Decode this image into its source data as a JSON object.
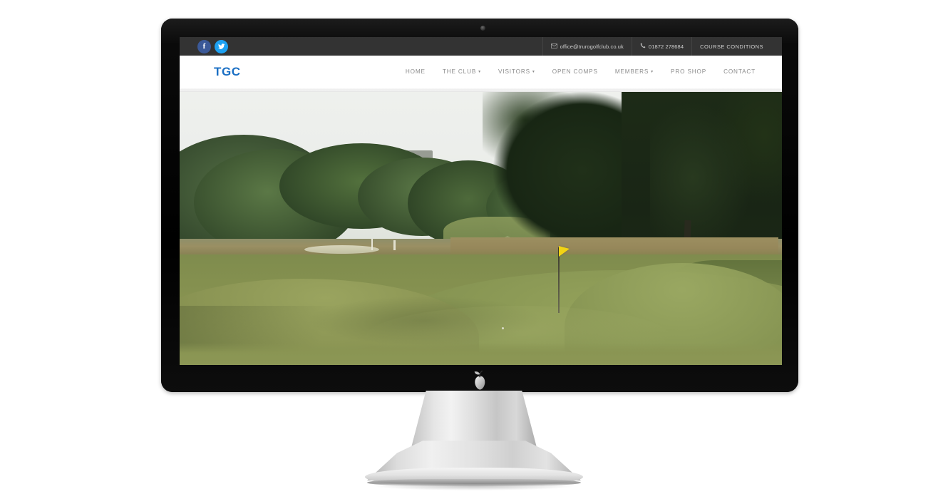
{
  "device": {
    "type": "desktop-monitor-mockup",
    "brand_logo": "pear-logo",
    "bezel_color": "#0b0b0b",
    "stand_color": "#d8d8d8"
  },
  "site": {
    "topbar": {
      "social": [
        {
          "name": "facebook",
          "glyph": "f",
          "color": "#3b5998"
        },
        {
          "name": "twitter",
          "glyph": "t",
          "color": "#1da1f2"
        }
      ],
      "contacts": [
        {
          "icon": "envelope-icon",
          "label": "office@trurogolfclub.co.uk"
        },
        {
          "icon": "phone-icon",
          "label": "01872 278684"
        }
      ],
      "link": "COURSE CONDITIONS",
      "background": "#333333",
      "text_color": "#cfcfcf"
    },
    "header": {
      "logo": "TGC",
      "logo_color": "#1a6fc4",
      "nav": [
        {
          "label": "HOME",
          "has_dropdown": false
        },
        {
          "label": "THE CLUB",
          "has_dropdown": true
        },
        {
          "label": "VISITORS",
          "has_dropdown": true
        },
        {
          "label": "OPEN COMPS",
          "has_dropdown": false
        },
        {
          "label": "MEMBERS",
          "has_dropdown": true
        },
        {
          "label": "PRO SHOP",
          "has_dropdown": false
        },
        {
          "label": "CONTACT",
          "has_dropdown": false
        }
      ],
      "nav_color": "#8b8b8b",
      "background": "#ffffff"
    },
    "hero": {
      "alt": "Golf course green with yellow flag, fairway and dense trees under an overcast sky",
      "sky_color": "#eceeeb",
      "fairway_color": "#8a9553",
      "tree_color": "#1d2b17",
      "flag_color": "#f2d413"
    }
  }
}
